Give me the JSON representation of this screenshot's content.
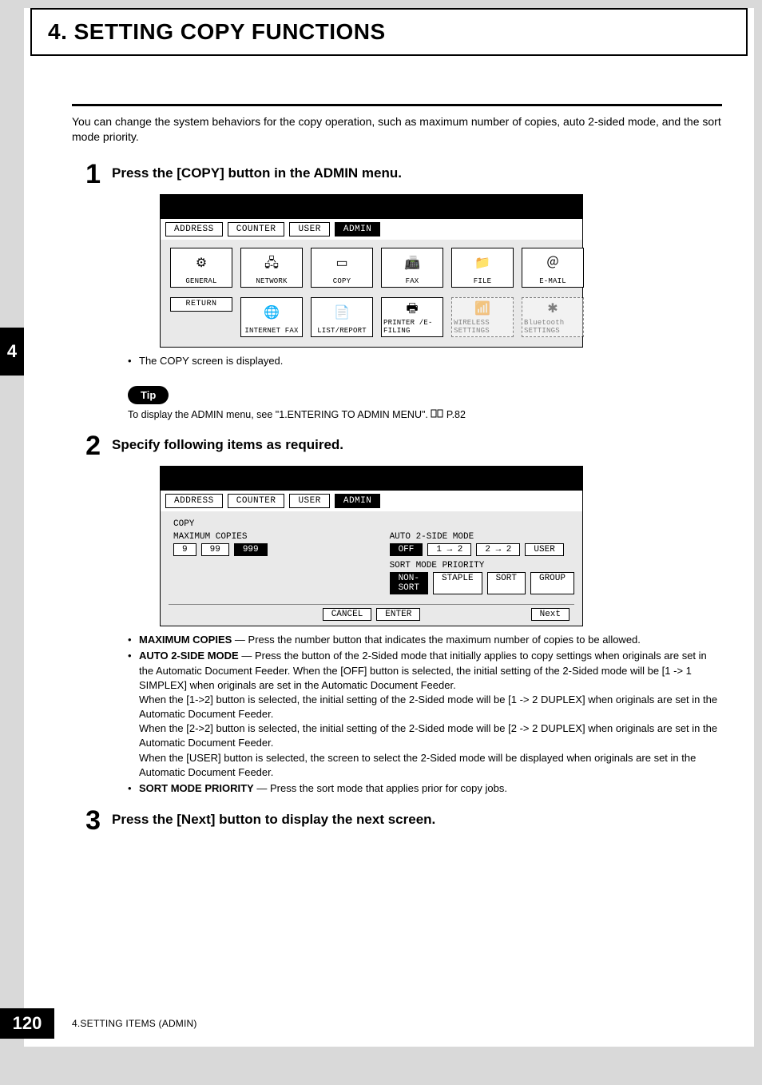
{
  "chapter": {
    "title": "4. SETTING COPY FUNCTIONS",
    "side_num": "4"
  },
  "intro": "You can change the system behaviors for the copy operation, such as maximum number of copies, auto 2-sided mode, and the sort mode priority.",
  "steps": {
    "s1": {
      "num": "1",
      "title": "Press the [COPY] button in the ADMIN menu."
    },
    "s2": {
      "num": "2",
      "title": "Specify following items as required."
    },
    "s3": {
      "num": "3",
      "title": "Press the [Next] button to display the next screen."
    }
  },
  "ss1": {
    "tabs": {
      "address": "ADDRESS",
      "counter": "COUNTER",
      "user": "USER",
      "admin": "ADMIN"
    },
    "cells": {
      "general": "GENERAL",
      "network": "NETWORK",
      "copy": "COPY",
      "fax": "FAX",
      "file": "FILE",
      "email": "E-MAIL",
      "ifax": "INTERNET FAX",
      "listrep": "LIST/REPORT",
      "printer": "PRINTER /E-FILING",
      "wireless": "WIRELESS SETTINGS",
      "bluetooth": "Bluetooth SETTINGS"
    },
    "return": "RETURN"
  },
  "after_ss1": "The COPY screen is displayed.",
  "tip": {
    "label": "Tip",
    "text_a": "To display the ADMIN menu, see \"1.ENTERING TO ADMIN MENU\".  ",
    "page_ref": "P.82"
  },
  "ss2": {
    "tabs": {
      "address": "ADDRESS",
      "counter": "COUNTER",
      "user": "USER",
      "admin": "ADMIN"
    },
    "heading": "COPY",
    "left_label": "MAXIMUM COPIES",
    "left_buttons": {
      "b1": "9",
      "b2": "99",
      "b3": "999"
    },
    "right_label1": "AUTO 2-SIDE MODE",
    "right_row1": {
      "b1": "OFF",
      "b2": "1 → 2",
      "b3": "2 → 2",
      "b4": "USER"
    },
    "right_label2": "SORT MODE PRIORITY",
    "right_row2": {
      "b1": "NON-SORT",
      "b2": "STAPLE",
      "b3": "SORT",
      "b4": "GROUP"
    },
    "footer": {
      "cancel": "CANCEL",
      "enter": "ENTER",
      "next": "Next"
    }
  },
  "desc": {
    "max_head": "MAXIMUM COPIES",
    "max_body": " — Press the number button that indicates the maximum number of copies to be allowed.",
    "auto_head": "AUTO 2-SIDE MODE",
    "auto_body": " — Press the button of the 2-Sided mode that initially applies to copy settings when originals are set in the Automatic Document Feeder.  When the [OFF] button is selected, the initial setting of the 2-Sided mode will be [1 -> 1 SIMPLEX] when originals are set in the Automatic Document Feeder.",
    "auto_p2": "When the [1->2] button is selected, the initial setting of the 2-Sided mode will be [1 -> 2 DUPLEX] when originals are set in the Automatic Document Feeder.",
    "auto_p3": "When the [2->2] button is selected, the initial setting of the 2-Sided mode will be [2 -> 2 DUPLEX] when originals are set in the Automatic Document Feeder.",
    "auto_p4": "When the [USER] button is selected, the screen to select the 2-Sided mode will be displayed when originals are set in the Automatic Document Feeder.",
    "sort_head": "SORT MODE PRIORITY",
    "sort_body": " — Press the sort mode that applies prior for copy jobs."
  },
  "footer": {
    "page": "120",
    "text": "4.SETTING ITEMS (ADMIN)"
  }
}
